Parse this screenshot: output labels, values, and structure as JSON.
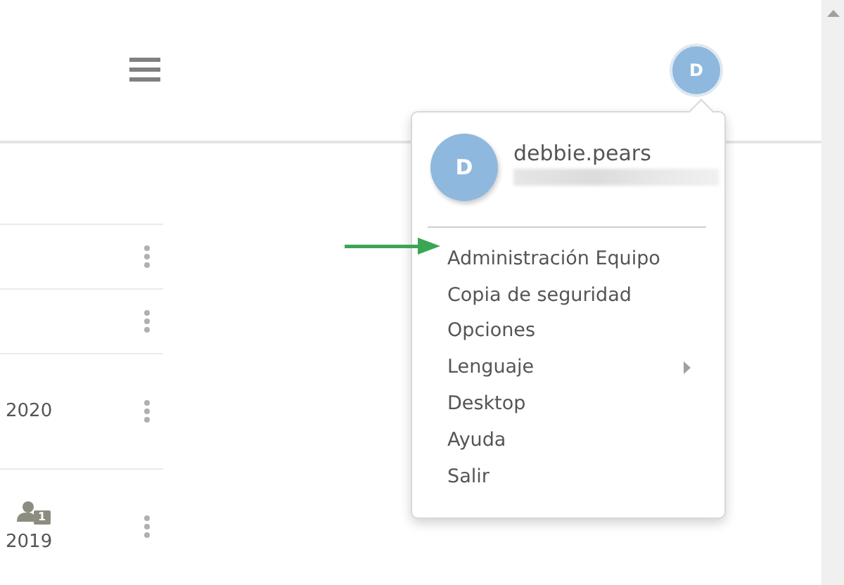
{
  "header": {
    "avatar_initial": "D"
  },
  "rows": [
    {
      "year": null,
      "badge": null
    },
    {
      "year": null,
      "badge": null
    },
    {
      "year": "2020",
      "badge": null
    },
    {
      "year": "2019",
      "badge": "1"
    }
  ],
  "user_menu": {
    "avatar_initial": "D",
    "username": "debbie.pears",
    "email_redacted": true,
    "items": [
      {
        "label": "Administración Equipo",
        "kind": "link"
      },
      {
        "label": "Copia de seguridad",
        "kind": "link"
      },
      {
        "label": "Opciones",
        "kind": "link"
      },
      {
        "label": "Lenguaje",
        "kind": "submenu"
      },
      {
        "label": "Desktop",
        "kind": "link"
      },
      {
        "label": "Ayuda",
        "kind": "link"
      },
      {
        "label": "Salir",
        "kind": "link"
      }
    ]
  },
  "annotations": [
    {
      "kind": "arrow"
    }
  ]
}
